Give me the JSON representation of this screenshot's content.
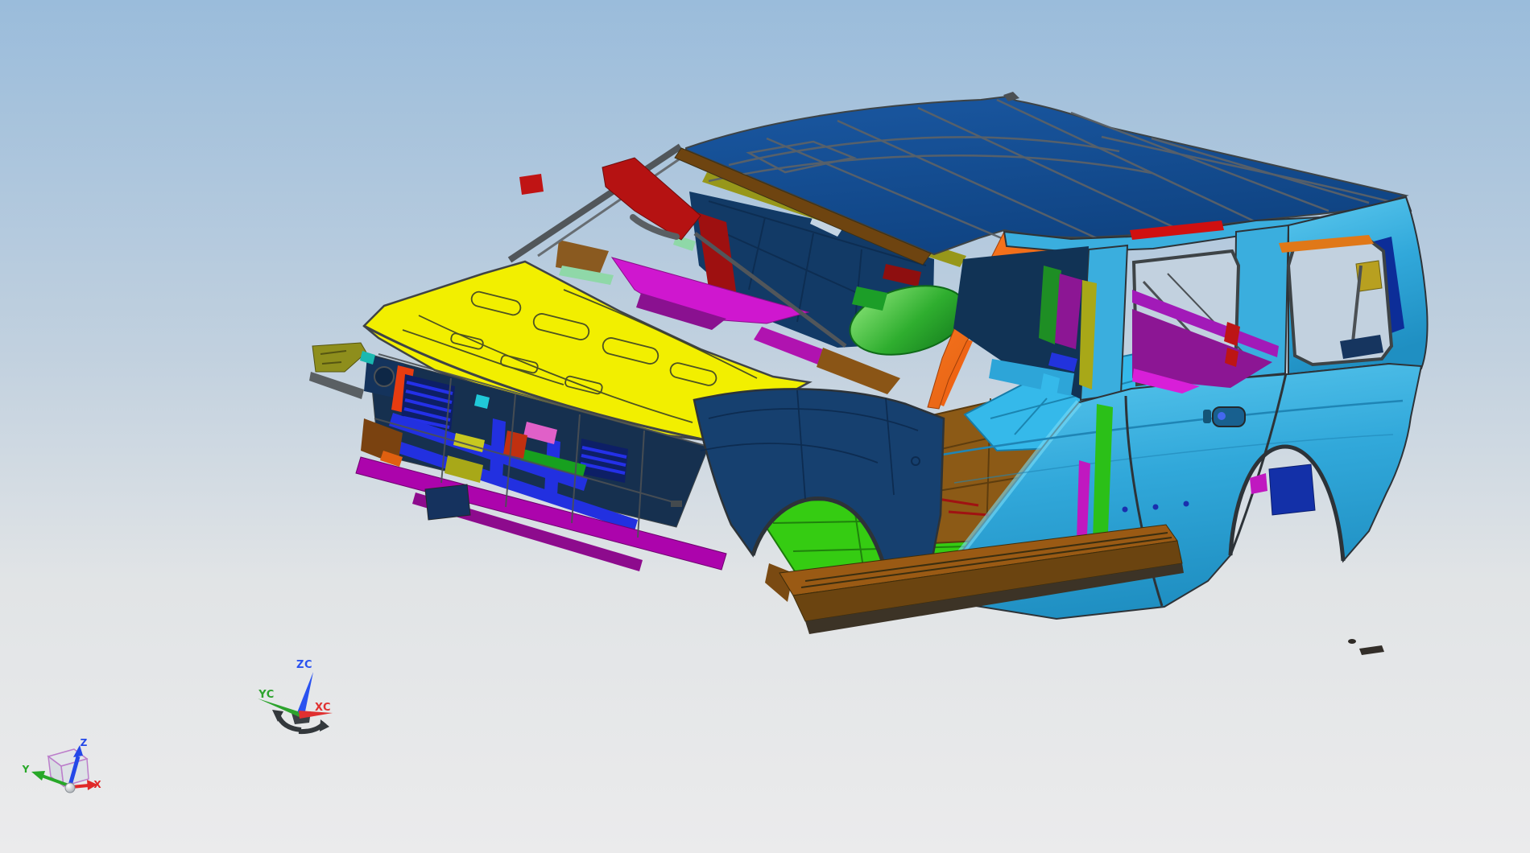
{
  "viewport": {
    "bg_top": "#9abcdb",
    "bg_mid": "#c2d1df",
    "bg_low": "#e1e4e6",
    "bg_bottom": "#ebebec"
  },
  "wcs_triad": {
    "z": "ZC",
    "y": "YC",
    "x": "XC"
  },
  "view_triad": {
    "z": "Z",
    "y": "Y",
    "x": "X"
  },
  "palette": {
    "bg_top": "#9abcdb",
    "bg_mid": "#c2d1df",
    "bg_low": "#e1e4e6",
    "bg_bottom": "#ebebec",
    "roof": "#134e8e",
    "roof_dark": "#0e4179",
    "edge_gray": "#4b5054",
    "line_gray": "#575f66",
    "header_brown": "#6e4410",
    "olive_strip": "#97971a",
    "olive": "#8e8e1c",
    "hood_yellow": "#f2ef00",
    "hood_line": "#3c4226",
    "body_cyan": "#2da5d8",
    "body_cyan_light": "#56c6ee",
    "body_cyan_dark": "#2496c8",
    "pillar_cyan": "#3aaede",
    "sill_teal": "#2fd6de",
    "fender_navy": "#16406f",
    "dash_navy": "#123a66",
    "window_bg": "#c2d1df",
    "pillar_orange": "#ef6414",
    "apillar_red": "#b51212",
    "strip_red": "#d01010",
    "cowl_magenta": "#cf17cf",
    "magenta_dark": "#b013b0",
    "rail_purple": "#8c1694",
    "rail_purple_bright": "#a21ab8",
    "bumper_magenta": "#ac04ac",
    "grille_blue": "#2230e0",
    "slat_navy": "#0d1f66",
    "floor_green": "#35cc12",
    "seat_green": "#2fae2f",
    "floor_brown": "#8c5a16",
    "rocker_brown": "#9a5a14",
    "rocker_dark": "#6b4410",
    "arch_navy_box": "#1330a8",
    "wcs_z": "#2a52f0",
    "wcs_y": "#2da32d",
    "wcs_x": "#e03030",
    "handle_dark": "#3a3f44",
    "tri_z": "#2448e8",
    "tri_y": "#28a828",
    "tri_x": "#e02828",
    "cube_edge": "#bc7ecb"
  }
}
